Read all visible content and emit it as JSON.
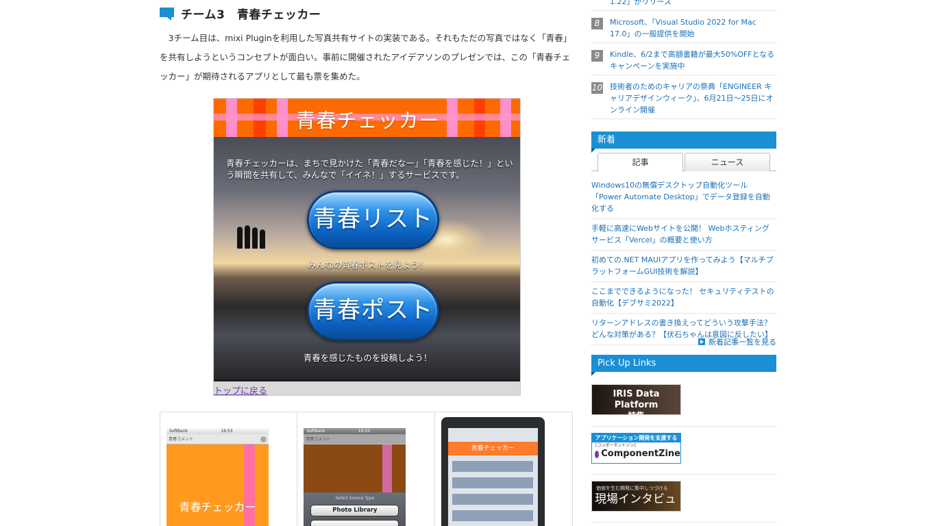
{
  "article": {
    "section_title": "チーム3　青春チェッカー",
    "paragraph": "　3チーム目は、mixi Pluginを利用した写真共有サイトの実装である。それもただの写真ではなく「青春」を共有しようというコンセプトが面白い。事前に開催されたアイデアソンのプレゼンでは、この「青春チェッカー」が期待されるアプリとして最も票を集めた。"
  },
  "hero": {
    "banner_title": "青春チェッカー",
    "description": "青春チェッカーは、まちで見かけた「青春だなー」「青春を感じた！」という瞬間を共有して、みんなで「イイネ！」するサービスです。",
    "button1_label": "青春リスト",
    "caption1": "みんなの青春ポストを見よう！",
    "button2_label": "青春ポスト",
    "caption2": "青春を感じたものを投稿しよう！",
    "footer_link": "トップに戻る"
  },
  "thumbnails": {
    "thumb1": {
      "carrier": "SoftBank",
      "time": "16:53",
      "url_text": "青春コメント",
      "title": "青春チェッカー"
    },
    "thumb2": {
      "carrier": "SoftBank",
      "time": "16:53",
      "url_text": "青春コメント",
      "sheet_title": "Select Source Type",
      "button1": "Photo Library"
    },
    "thumb3": {
      "banner": "青春チェッカー"
    }
  },
  "sidebar": {
    "ranking": [
      {
        "num": "",
        "text": "1.22」がリリース"
      },
      {
        "num": "8",
        "text": "Microsoft、「Visual Studio 2022 for Mac 17.0」の一般提供を開始"
      },
      {
        "num": "9",
        "text": "Kindle、6/2まで高額書籍が最大50%OFFとなるキャンペーンを実施中"
      },
      {
        "num": "10",
        "text": "技術者のためのキャリアの祭典「ENGINEER キャリアデザインウィーク」、6月21日〜25日にオンライン開催"
      }
    ],
    "new_heading": "新着",
    "tabs": [
      "記事",
      "ニュース"
    ],
    "news": [
      "Windows10の無償デスクトップ自動化ツール「Power Automate Desktop」でデータ登録を自動化する",
      "手軽に高速にWebサイトを公開！ Webホスティングサービス「Vercel」の概要と使い方",
      "初めての.NET MAUIアプリを作ってみよう【マルチプラットフォームGUI技術を解説】",
      "ここまでできるようになった！ セキュリティテストの自動化【デブサミ2022】",
      "リターンアドレスの書き換えってどういう攻撃手法？どんな対策がある？【伏石ちゃんは意図に反したい】"
    ],
    "more_link": "新着記事一覧を見る",
    "pickup_heading": "Pick Up Links",
    "banners": {
      "iris_line1": "IRIS Data Platform",
      "iris_line2": "特集",
      "cz_top": "アプリケーション開発を支援する",
      "cz_sub": "[コンポーネントジン]",
      "cz_logo": "ComponentZine",
      "genba_small": "価値を生む開発に集中しつづける",
      "genba_big": "現場インタビュー"
    }
  },
  "colors": {
    "accent": "#1a8fd4",
    "link": "#1a6fb5",
    "hero_banner": "#ff6a00"
  }
}
